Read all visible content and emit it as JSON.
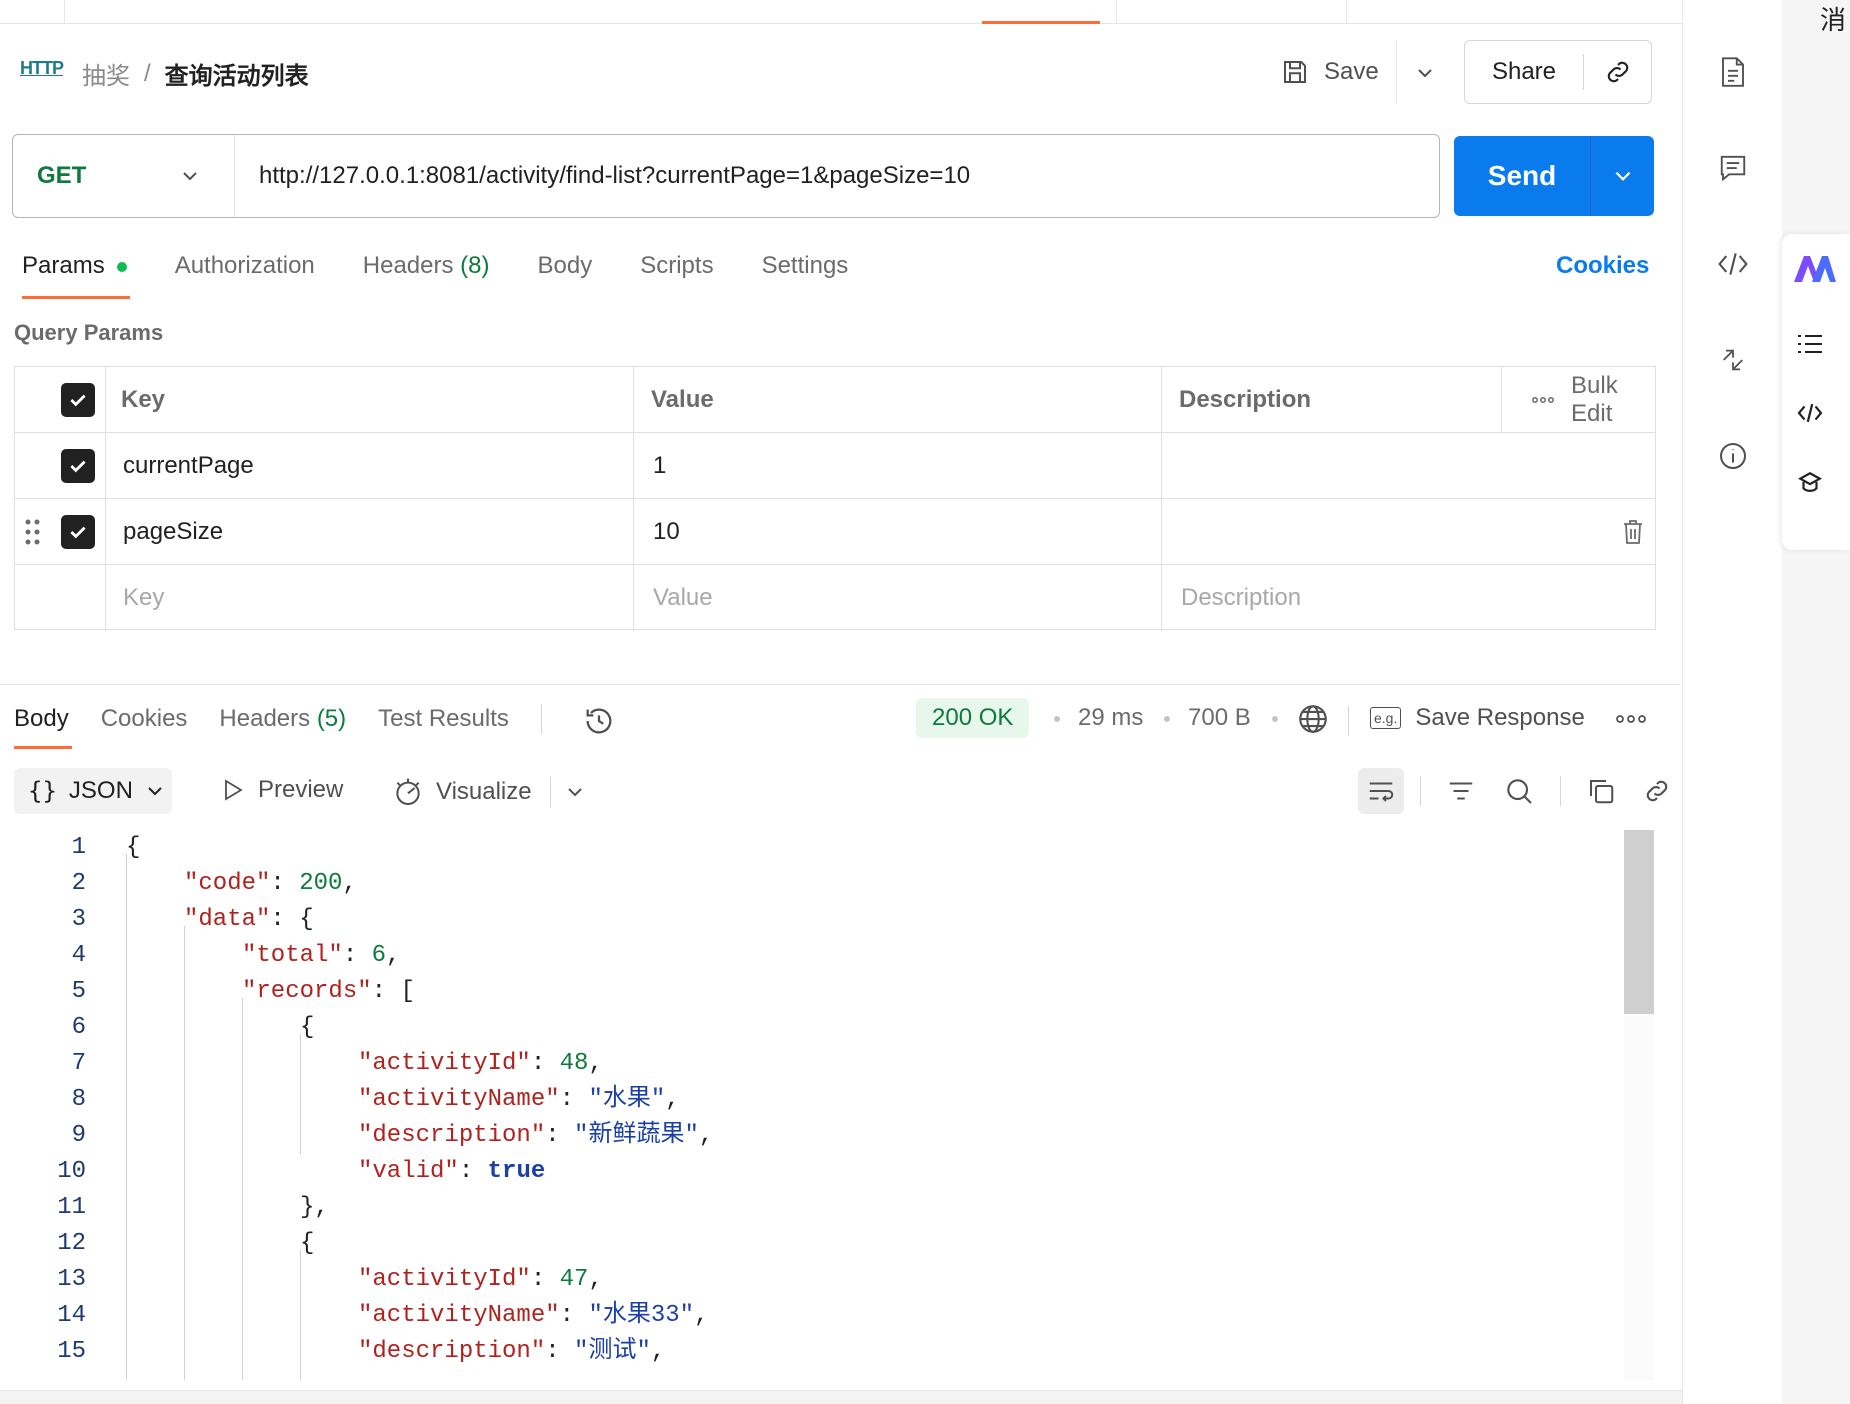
{
  "breadcrumb": {
    "protocol_badge": "HTTP",
    "parent": "抽奖",
    "separator": "/",
    "current": "查询活动列表"
  },
  "header": {
    "save_label": "Save",
    "share_label": "Share"
  },
  "request": {
    "method": "GET",
    "url": "http://127.0.0.1:8081/activity/find-list?currentPage=1&pageSize=10",
    "send_label": "Send"
  },
  "request_tabs": {
    "params": "Params",
    "authorization": "Authorization",
    "headers": "Headers",
    "headers_count": "(8)",
    "body": "Body",
    "scripts": "Scripts",
    "settings": "Settings",
    "cookies": "Cookies"
  },
  "query_params": {
    "title": "Query Params",
    "columns": {
      "key": "Key",
      "value": "Value",
      "description": "Description",
      "bulk_edit": "Bulk Edit"
    },
    "rows": [
      {
        "key": "currentPage",
        "value": "1",
        "description": ""
      },
      {
        "key": "pageSize",
        "value": "10",
        "description": ""
      }
    ],
    "placeholders": {
      "key": "Key",
      "value": "Value",
      "description": "Description"
    }
  },
  "response_tabs": {
    "body": "Body",
    "cookies": "Cookies",
    "headers": "Headers",
    "headers_count": "(5)",
    "test_results": "Test Results"
  },
  "response_meta": {
    "status": "200 OK",
    "time": "29 ms",
    "size": "700 B",
    "save_response": "Save Response",
    "eg_badge": "e.g."
  },
  "viewer": {
    "format": "JSON",
    "preview": "Preview",
    "visualize": "Visualize"
  },
  "code_lines": {
    "l1": {
      "n": "1",
      "t": "{"
    },
    "l2": {
      "n": "2",
      "k": "\"code\"",
      "v": "200"
    },
    "l3": {
      "n": "3",
      "k": "\"data\"",
      "t": "{"
    },
    "l4": {
      "n": "4",
      "k": "\"total\"",
      "v": "6"
    },
    "l5": {
      "n": "5",
      "k": "\"records\"",
      "t": "["
    },
    "l6": {
      "n": "6",
      "t": "{"
    },
    "l7": {
      "n": "7",
      "k": "\"activityId\"",
      "v": "48"
    },
    "l8": {
      "n": "8",
      "k": "\"activityName\"",
      "s": "\"水果\""
    },
    "l9": {
      "n": "9",
      "k": "\"description\"",
      "s": "\"新鲜蔬果\""
    },
    "l10": {
      "n": "10",
      "k": "\"valid\"",
      "b": "true"
    },
    "l11": {
      "n": "11",
      "t": "},"
    },
    "l12": {
      "n": "12",
      "t": "{"
    },
    "l13": {
      "n": "13",
      "k": "\"activityId\"",
      "v": "47"
    },
    "l14": {
      "n": "14",
      "k": "\"activityName\"",
      "s": "\"水果33\""
    },
    "l15": {
      "n": "15",
      "k": "\"description\"",
      "s": "\"测试\""
    }
  },
  "side_panel": {
    "top_char": "消"
  },
  "colors": {
    "accent_orange": "#ff6c37",
    "send_blue": "#097bed",
    "method_green": "#0f7a3e"
  }
}
